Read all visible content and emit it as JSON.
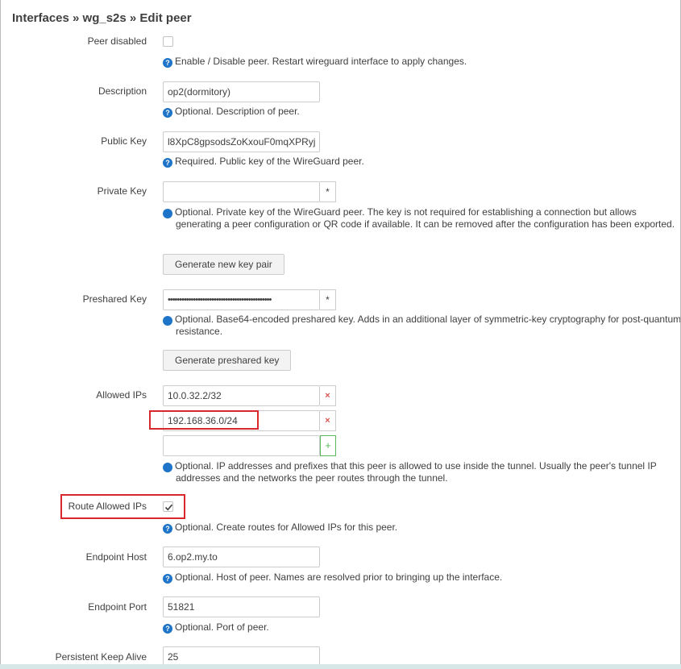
{
  "breadcrumb": "Interfaces » wg_s2s » Edit peer",
  "fields": {
    "peer_disabled": {
      "label": "Peer disabled",
      "checked": false,
      "help": "Enable / Disable peer. Restart wireguard interface to apply changes."
    },
    "description": {
      "label": "Description",
      "value": "op2(dormitory)",
      "help": "Optional. Description of peer."
    },
    "public_key": {
      "label": "Public Key",
      "value": "l8XpC8gpsodsZoKxouF0mqXPRyj",
      "help": "Required. Public key of the WireGuard peer."
    },
    "private_key": {
      "label": "Private Key",
      "value": "",
      "toggle_label": "*",
      "help": "Optional. Private key of the WireGuard peer. The key is not required for establishing a connection but allows generating a peer configuration or QR code if available. It can be removed after the configuration has been exported.",
      "button_label": "Generate new key pair"
    },
    "preshared_key": {
      "label": "Preshared Key",
      "value": "•••••••••••••••••••••••••••••••••••••••••••••",
      "toggle_label": "*",
      "help": "Optional. Base64-encoded preshared key. Adds in an additional layer of symmetric-key cryptography for post-quantum resistance.",
      "button_label": "Generate preshared key"
    },
    "allowed_ips": {
      "label": "Allowed IPs",
      "entries": [
        "10.0.32.2/32",
        "192.168.36.0/24"
      ],
      "new_entry": "",
      "remove_label": "×",
      "add_label": "+",
      "help": "Optional. IP addresses and prefixes that this peer is allowed to use inside the tunnel. Usually the peer's tunnel IP addresses and the networks the peer routes through the tunnel."
    },
    "route_allowed_ips": {
      "label": "Route Allowed IPs",
      "checked": true,
      "help": "Optional. Create routes for Allowed IPs for this peer."
    },
    "endpoint_host": {
      "label": "Endpoint Host",
      "value": "6.op2.my.to",
      "help": "Optional. Host of peer. Names are resolved prior to bringing up the interface."
    },
    "endpoint_port": {
      "label": "Endpoint Port",
      "value": "51821",
      "help": "Optional. Port of peer."
    },
    "persistent_keepalive": {
      "label": "Persistent Keep Alive",
      "value": "25"
    }
  },
  "help_icon": "question-circle-icon",
  "colors": {
    "help_icon": "#1e74c8",
    "highlight": "#d9272e",
    "remove": "#d9534f",
    "add": "#5cb85c"
  }
}
